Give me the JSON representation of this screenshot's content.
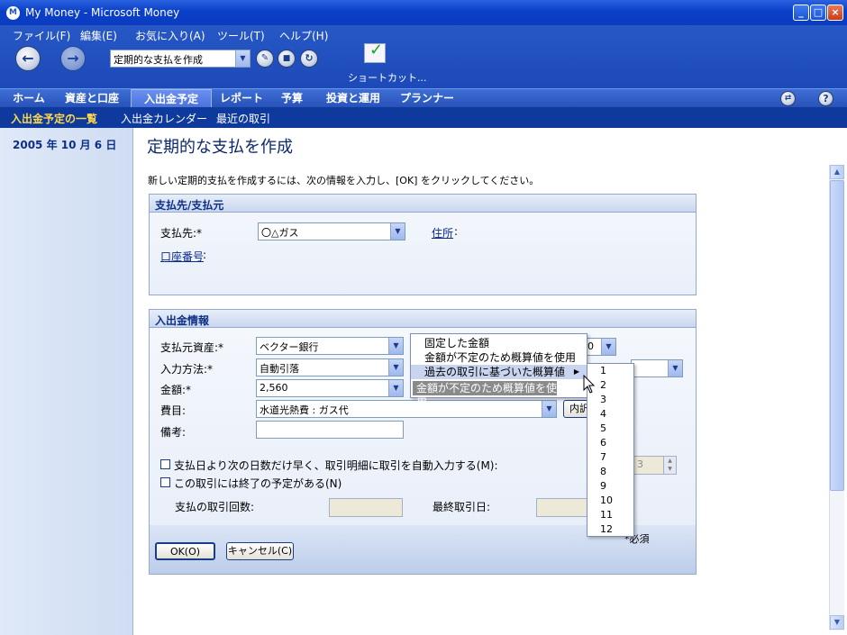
{
  "window": {
    "title": "My Money - Microsoft Money",
    "app_icon_letter": "M"
  },
  "menubar": [
    "ファイル(F)",
    "編集(E)",
    "お気に入り(A)",
    "ツール(T)",
    "ヘルプ(H)"
  ],
  "toolbar": {
    "address_value": "定期的な支払を作成",
    "shortcut_label": "ショートカット..."
  },
  "nav": {
    "tabs": [
      "ホーム",
      "資産と口座",
      "入出金予定",
      "レポート",
      "予算",
      "投資と運用",
      "プランナー"
    ],
    "active": "入出金予定"
  },
  "subnav": [
    "入出金予定の一覧",
    "入出金カレンダー",
    "最近の取引"
  ],
  "sidebar": {
    "date": "2005 年 10 月 6 日"
  },
  "page": {
    "title": "定期的な支払を作成",
    "intro": "新しい定期的支払を作成するには、次の情報を入力し、[OK] をクリックしてください。",
    "payee_section": {
      "title": "支払先/支払元",
      "payee_label": "支払先:*",
      "payee_value": "〇△ガス",
      "address_link": "住所",
      "account_link": "口座番号"
    },
    "txn_section": {
      "title": "入出金情報",
      "from_account_label": "支払元資産:*",
      "from_account_value": "ベクター銀行",
      "method_label": "入力方法:*",
      "method_value": "自動引落",
      "amount_label": "金額:*",
      "amount_value": "2,560",
      "category_label": "費目:",
      "category_value": "水道光熱費 : ガス代",
      "details_button": "内訳",
      "memo_label": "備考:",
      "partial_day_value": "0",
      "auto_enter_label": "支払日より次の日数だけ早く、取引明細に取引を自動入力する(M):",
      "auto_enter_days": "3",
      "end_label": "この取引には終了の予定がある(N)",
      "count_label": "支払の取引回数:",
      "last_date_label": "最終取引日:"
    },
    "required_note": "*必須",
    "ok_button": "OK(O)",
    "cancel_button": "キャンセル(C)"
  },
  "amount_menu": {
    "items": [
      "固定した金額",
      "金額が不定のため概算値を使用",
      "過去の取引に基づいた概算値",
      "金額が不定のため概算値を使用"
    ],
    "highlighted_index": 2
  },
  "count_menu": {
    "items": [
      "1",
      "2",
      "3",
      "4",
      "5",
      "6",
      "7",
      "8",
      "9",
      "10",
      "11",
      "12"
    ]
  },
  "colors": {
    "titlebar": "#0a3fc8",
    "nav_bar": "#2852b8",
    "subnav_bar": "#0e3a9e",
    "active_subnav_text": "#ffd84a",
    "menu_highlight": "#c9d5ef"
  }
}
